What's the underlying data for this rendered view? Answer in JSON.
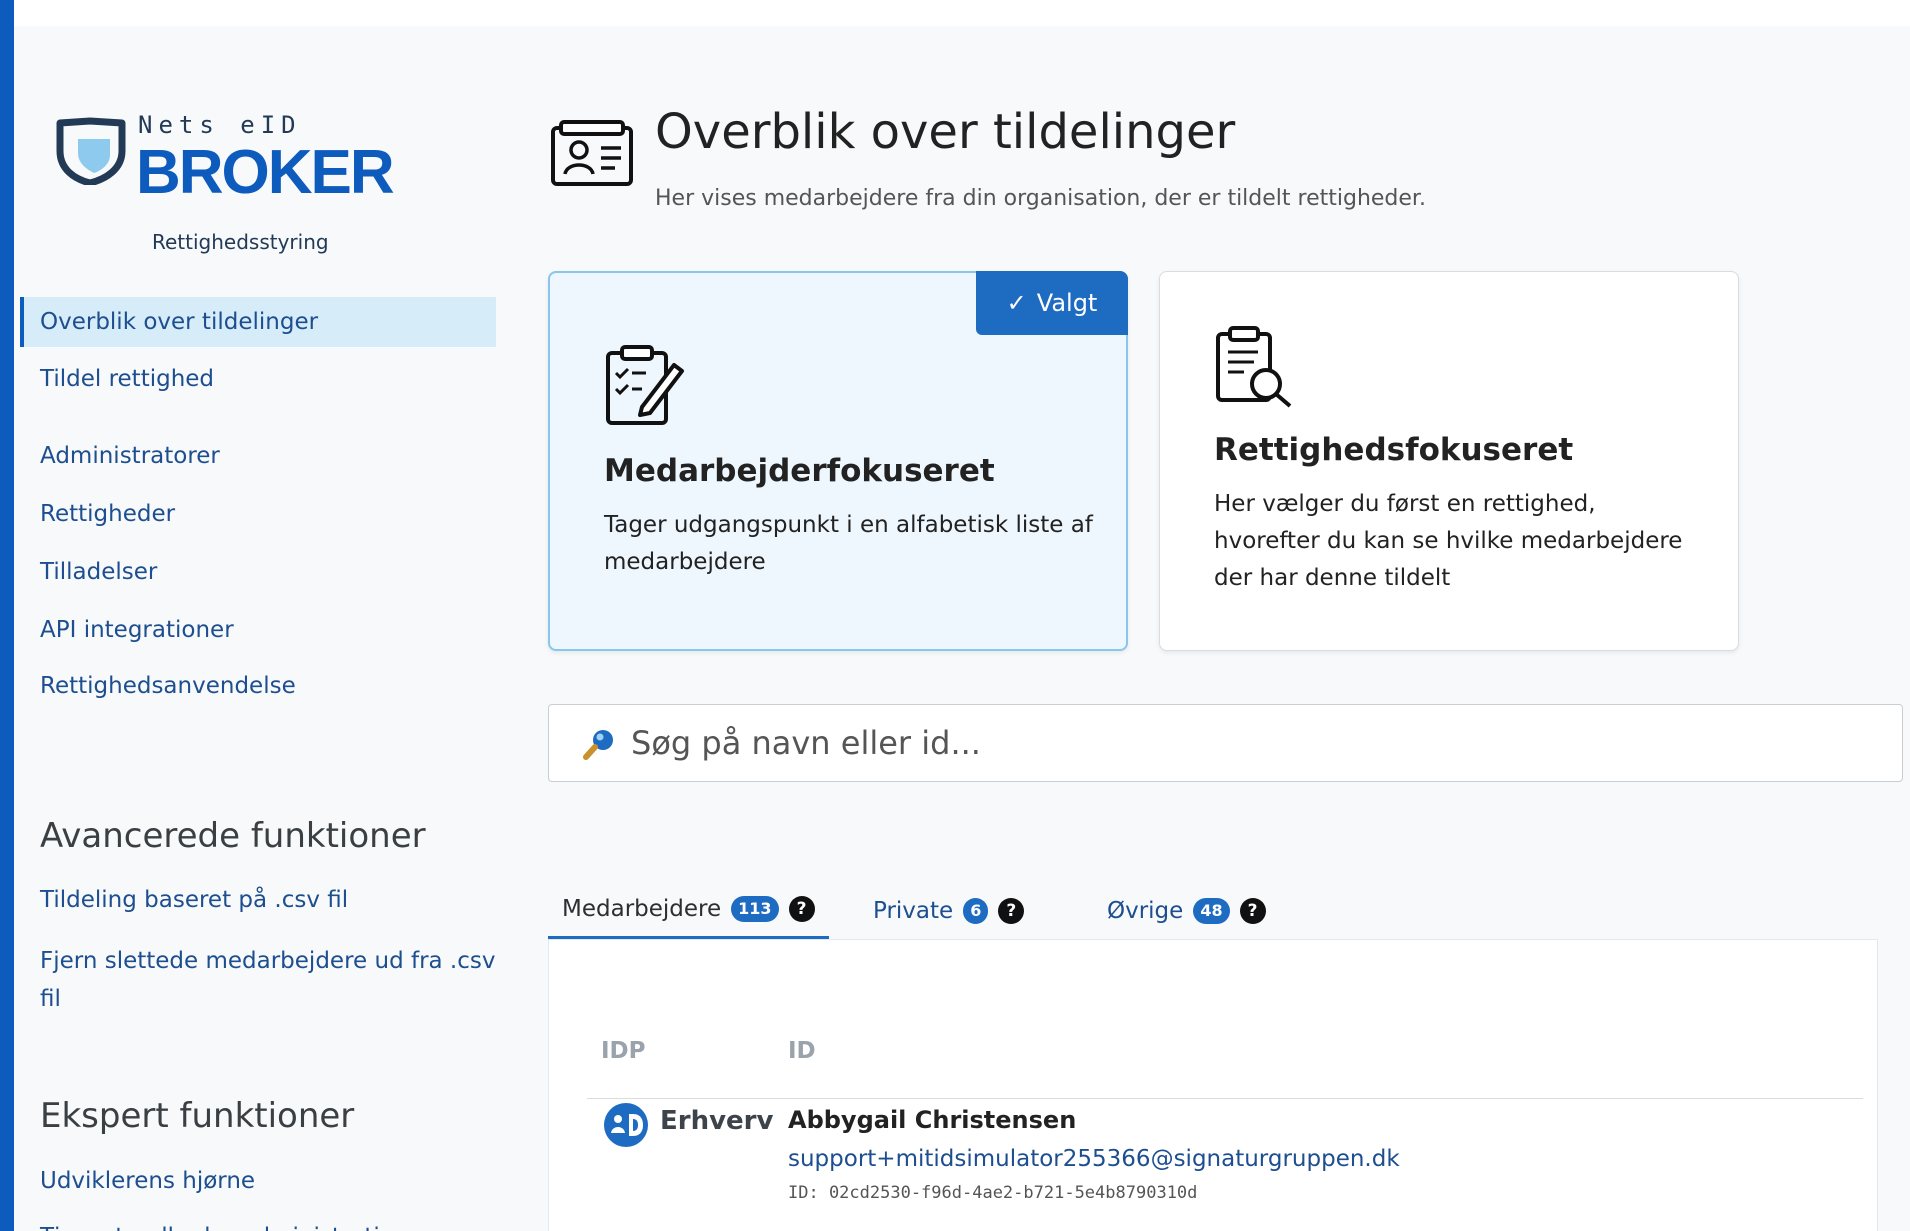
{
  "app": {
    "logo_brand": "Nets eID",
    "logo_product": "BROKER",
    "logo_subtitle": "Rettighedsstyring"
  },
  "sidebar": {
    "items": [
      {
        "label": "Overblik over tildelinger",
        "active": true
      },
      {
        "label": "Tildel rettighed"
      },
      {
        "label": "Administratorer"
      },
      {
        "label": "Rettigheder"
      },
      {
        "label": "Tilladelser"
      },
      {
        "label": "API integrationer"
      },
      {
        "label": "Rettighedsanvendelse"
      }
    ],
    "advanced": {
      "heading": "Avancerede funktioner",
      "items": [
        {
          "label": "Tildeling baseret på .csv fil"
        },
        {
          "label": "Fjern slettede medarbejdere ud fra .csv fil"
        }
      ]
    },
    "expert": {
      "heading": "Ekspert funktioner",
      "items": [
        {
          "label": "Udviklerens hjørne"
        },
        {
          "label": "Tjenesteudbyder administration"
        }
      ]
    }
  },
  "header": {
    "title": "Overblik over tildelinger",
    "subtitle": "Her vises medarbejdere fra din organisation, der er tildelt rettigheder."
  },
  "cards": [
    {
      "title": "Medarbejderfokuseret",
      "description": "Tager udgangspunkt i en alfabetisk liste af medarbejdere",
      "selected": true,
      "badge": "Valgt",
      "icon": "clipboard-pen-icon"
    },
    {
      "title": "Rettighedsfokuseret",
      "description": "Her vælger du først en rettighed, hvorefter du kan se hvilke medarbejdere der har denne tildelt",
      "selected": false,
      "icon": "clipboard-search-icon"
    }
  ],
  "search": {
    "placeholder": "Søg på navn eller id...",
    "value": "",
    "icon": "search-icon"
  },
  "tabs": [
    {
      "label": "Medarbejdere",
      "count": "113",
      "active": true
    },
    {
      "label": "Private",
      "count": "6"
    },
    {
      "label": "Øvrige",
      "count": "48"
    }
  ],
  "help_glyph": "?",
  "table": {
    "columns": [
      "IDP",
      "ID"
    ],
    "rows": [
      {
        "idp": "Erhverv",
        "name": "Abbygail Christensen",
        "email": "support+mitidsimulator255366@signaturgruppen.dk",
        "id": "ID: 02cd2530-f96d-4ae2-b721-5e4b8790310d"
      }
    ]
  },
  "colors": {
    "accent": "#1e6bc2",
    "brand": "#0d5bbd",
    "link": "#1d4e8f",
    "selected_bg": "#eef7fd"
  }
}
